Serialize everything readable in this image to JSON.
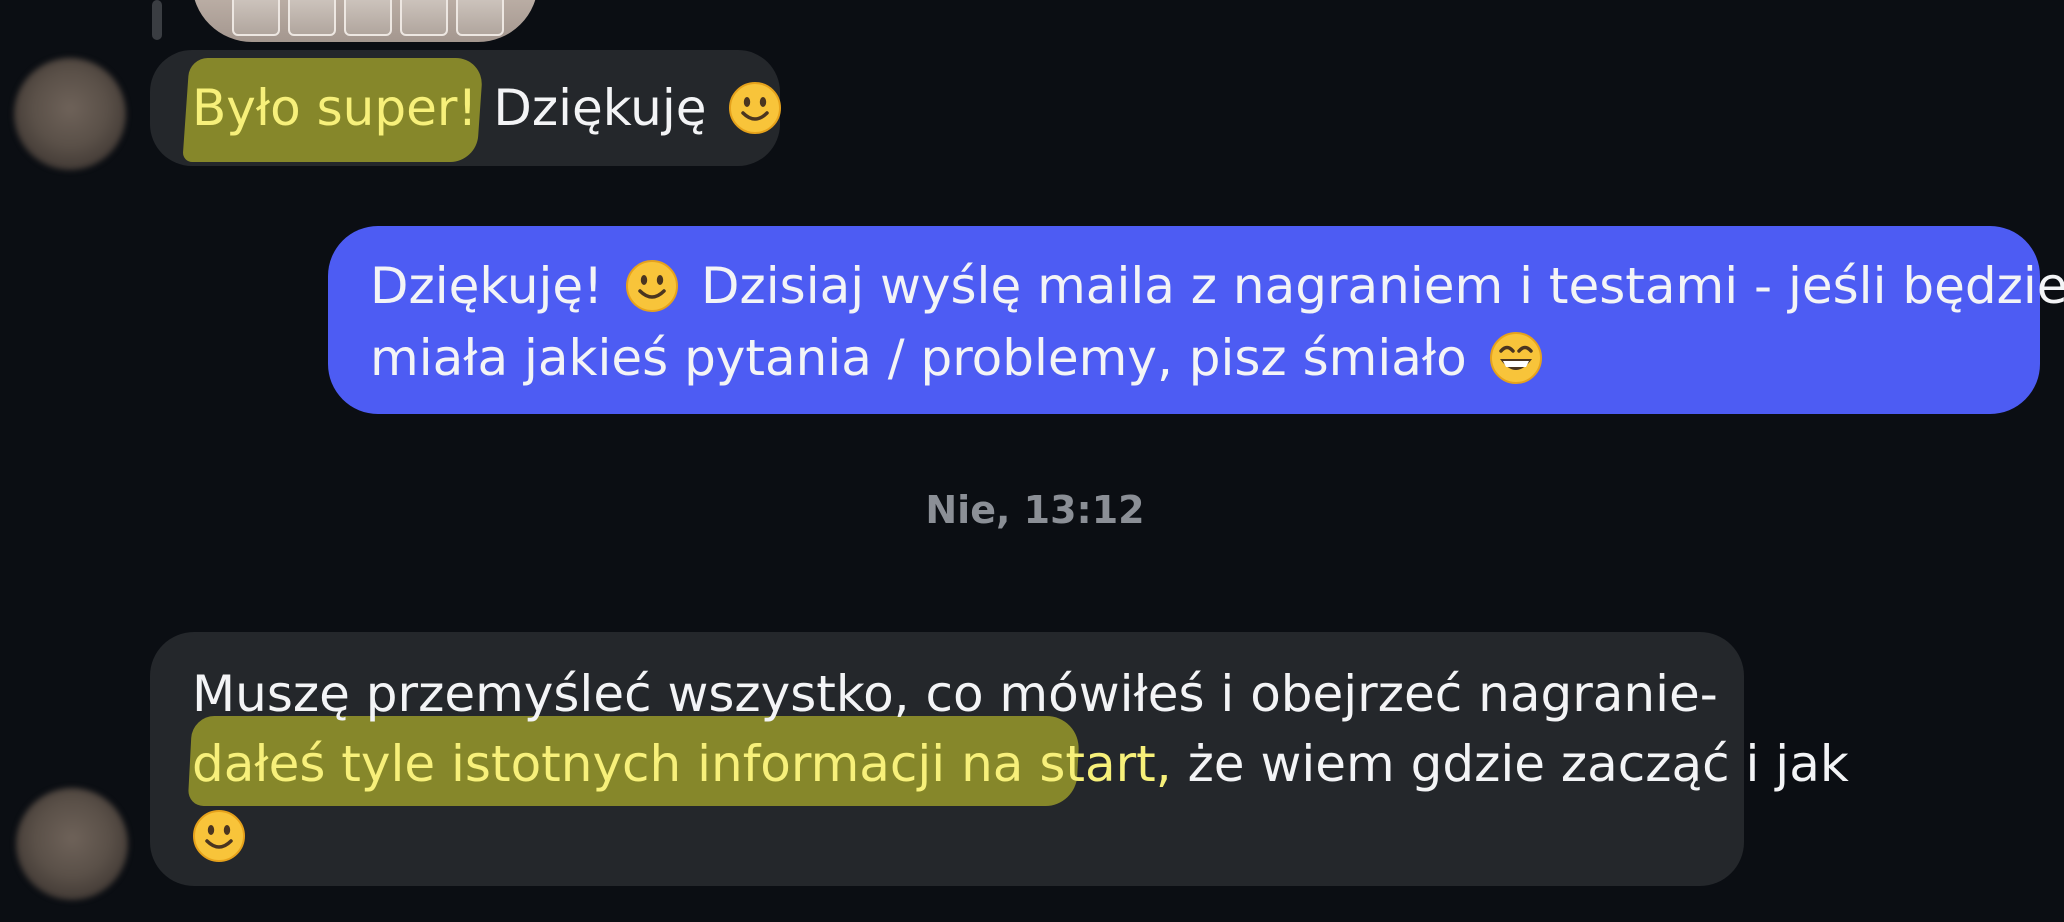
{
  "messages": [
    {
      "id": "m1",
      "direction": "incoming",
      "highlighted": "Było super!",
      "text": "Dziękuję",
      "emoji": "slightly-smiling-face-icon"
    },
    {
      "id": "m2",
      "direction": "outgoing",
      "line1_a": "Dziękuję!",
      "line1_b": "Dzisiaj wyślę maila z nagraniem i testami - jeśli będziesz",
      "line2": "miała jakieś pytania / problemy, pisz śmiało",
      "emoji_inline": "slightly-smiling-face-icon",
      "emoji_end": "grinning-face-with-smiling-eyes-icon"
    },
    {
      "id": "m3",
      "direction": "incoming",
      "line1": "Muszę przemyśleć wszystko, co mówiłeś i obejrzeć nagranie-",
      "line2_highlighted": "dałeś tyle istotnych informacji na start,",
      "line2_rest": " że wiem gdzie zacząć i jak",
      "emoji_end": "slightly-smiling-face-icon"
    }
  ],
  "timestamp": "Nie, 13:12",
  "colors": {
    "background": "#0b0e13",
    "incoming_bubble": "#24272b",
    "outgoing_bubble": "#4d5cf3",
    "highlight": "#8c8c2a",
    "highlight_text": "#f7f07a",
    "timestamp_text": "#8b8f96"
  }
}
